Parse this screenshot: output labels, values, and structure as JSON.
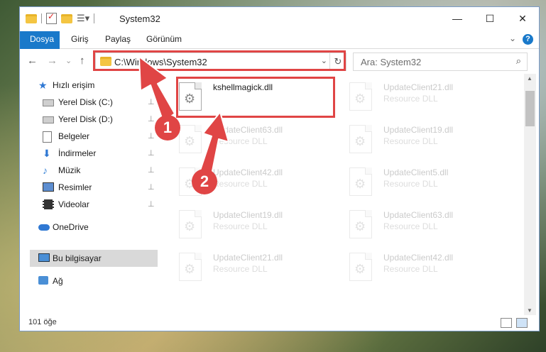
{
  "window": {
    "title": "System32",
    "minimize_glyph": "—",
    "maximize_glyph": "☐",
    "close_glyph": "✕"
  },
  "ribbon": {
    "tabs": [
      "Dosya",
      "Giriş",
      "Paylaş",
      "Görünüm"
    ],
    "help_glyph": "?",
    "chevron_glyph": "⌄"
  },
  "nav": {
    "back_glyph": "←",
    "forward_glyph": "→",
    "recent_glyph": "⌄",
    "up_glyph": "↑",
    "address_path": "C:\\Windows\\System32",
    "address_dropdown_glyph": "⌄",
    "refresh_glyph": "↻",
    "search_placeholder": "Ara: System32",
    "search_glyph": "⌕"
  },
  "sidebar": {
    "quick_access": "Hızlı erişim",
    "items": [
      {
        "label": "Yerel Disk (C:)",
        "icon": "drive-icon"
      },
      {
        "label": "Yerel Disk (D:)",
        "icon": "drive-icon"
      },
      {
        "label": "Belgeler",
        "icon": "document-icon"
      },
      {
        "label": "İndirmeler",
        "icon": "download-icon"
      },
      {
        "label": "Müzik",
        "icon": "music-icon"
      },
      {
        "label": "Resimler",
        "icon": "pictures-icon"
      },
      {
        "label": "Videolar",
        "icon": "video-icon"
      }
    ],
    "onedrive": "OneDrive",
    "this_pc": "Bu bilgisayar",
    "network": "Ağ",
    "pin_glyph": "📌"
  },
  "files": {
    "highlighted": {
      "name": "kshellmagick.dll",
      "type": ""
    },
    "ghosts": [
      {
        "name": "UpdateClient21.dll",
        "type": "Resource DLL"
      },
      {
        "name": "UpdateClient63.dll",
        "type": "Resource DLL"
      },
      {
        "name": "UpdateClient19.dll",
        "type": "Resource DLL"
      },
      {
        "name": "UpdateClient42.dll",
        "type": "Resource DLL"
      },
      {
        "name": "UpdateClient5.dll",
        "type": "Resource DLL"
      },
      {
        "name": "UpdateClient19.dll",
        "type": "Resource DLL"
      },
      {
        "name": "UpdateClient63.dll",
        "type": "Resource DLL"
      },
      {
        "name": "UpdateClient21.dll",
        "type": "Resource DLL"
      },
      {
        "name": "UpdateClient42.dll",
        "type": "Resource DLL"
      }
    ]
  },
  "status": {
    "item_count": "101 öğe"
  },
  "annotations": {
    "step1": "1",
    "step2": "2",
    "color": "#e04545"
  }
}
